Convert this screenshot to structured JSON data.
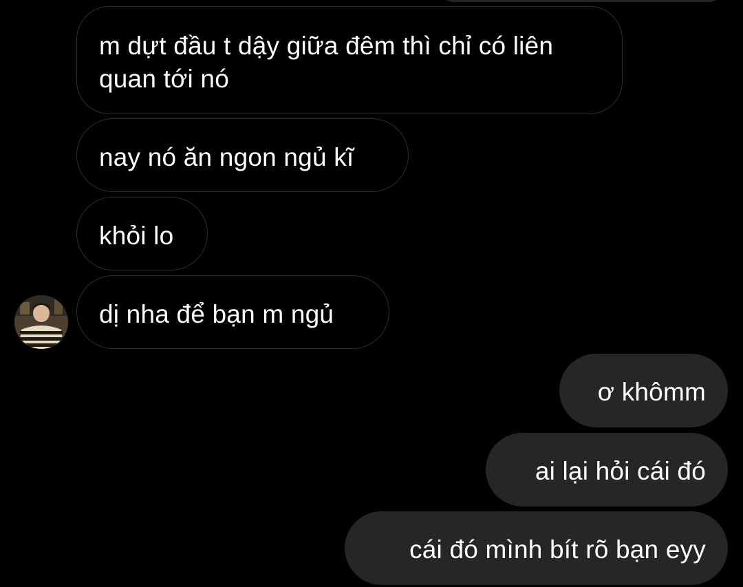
{
  "conversation": {
    "incoming_messages": [
      {
        "text": "m dựt đầu t dậy giữa đêm thì chỉ có liên quan tới nó"
      },
      {
        "text": "nay nó ăn ngon ngủ kĩ"
      },
      {
        "text": "khỏi lo"
      },
      {
        "text": "dị nha để bạn m ngủ"
      }
    ],
    "outgoing_messages": [
      {
        "text": "ơ khômm"
      },
      {
        "text": "ai lại hỏi cái đó"
      },
      {
        "text": "cái đó mình bít rõ bạn eyy"
      }
    ]
  },
  "colors": {
    "background": "#000000",
    "incoming_bubble_border": "#2e2e2e",
    "outgoing_bubble": "#262626",
    "text": "#ffffff"
  },
  "icons": {
    "sender_avatar": "avatar-photo"
  }
}
